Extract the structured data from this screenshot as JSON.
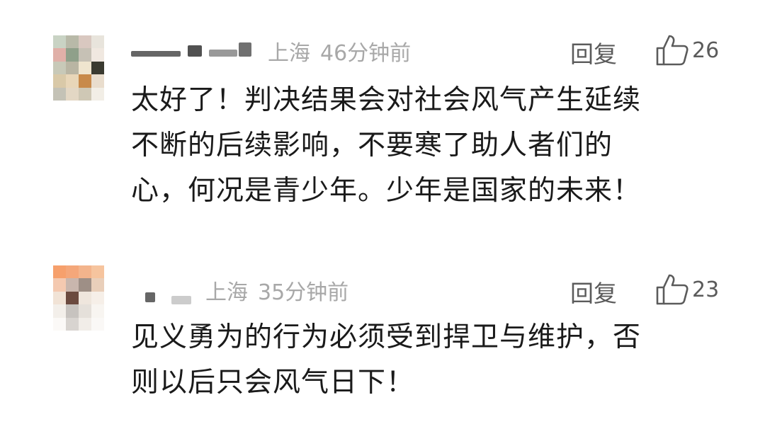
{
  "comments": [
    {
      "location": "上海",
      "time": "46分钟前",
      "reply_label": "回复",
      "likes": "26",
      "text_lines": [
        "太好了！判决结果会对社会风气产生延续",
        "不断的后续影响，不要寒了助人者们的",
        "心，何况是青少年。少年是国家的未来！"
      ],
      "avatar_colors": [
        "#c9d3c4",
        "#b8b9a8",
        "#d9c8c0",
        "#e8e4dc",
        "#e0b0a8",
        "#8fa08a",
        "#c6c1b5",
        "#f0e8e0",
        "#c8c9b8",
        "#b9b5a3",
        "#efe5cf",
        "#3a3a30",
        "#d9c9a8",
        "#e8d6b8",
        "#c88a4a",
        "#e9ddcd",
        "#c4c2b6",
        "#e3d7c4",
        "#cfc8b5",
        "#f2eee6"
      ]
    },
    {
      "location": "上海",
      "time": "35分钟前",
      "reply_label": "回复",
      "likes": "23",
      "text_lines": [
        "见义勇为的行为必须受到捍卫与维护，否",
        "则以后只会风气日下！"
      ],
      "avatar_colors": [
        "#f6a06c",
        "#f4a77a",
        "#f3b48c",
        "#f6c49e",
        "#f4c9b0",
        "#c9b6ad",
        "#9e8f86",
        "#e9cfba",
        "#f1e3d6",
        "#6b4a3f",
        "#efe6dd",
        "#f6efe8",
        "#f3efea",
        "#c7c3bf",
        "#e5e0da",
        "#f8f5f1",
        "#fbf9f7",
        "#d8d4d0",
        "#f1ede8",
        "#faf8f6"
      ]
    }
  ]
}
